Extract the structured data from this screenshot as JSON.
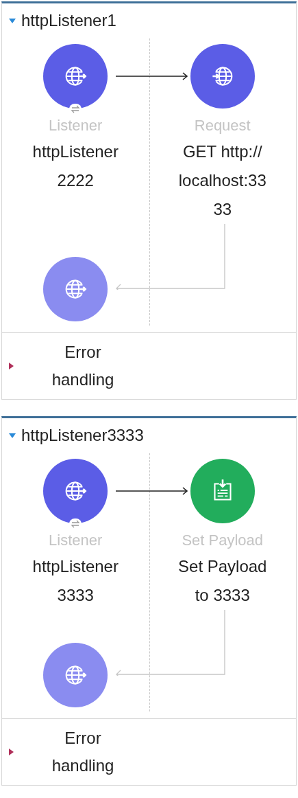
{
  "flows": [
    {
      "name": "httpListener1",
      "expanded": true,
      "nodes": [
        {
          "kind": "listener",
          "type_label": "Listener",
          "title_lines": [
            "httpListener",
            "2222"
          ]
        },
        {
          "kind": "request",
          "type_label": "Request",
          "title_lines": [
            "GET http://",
            "localhost:33",
            "33"
          ]
        }
      ],
      "response": {
        "kind": "listener-response"
      },
      "error_section": {
        "label_lines": [
          "Error",
          "handling"
        ],
        "expanded": false
      }
    },
    {
      "name": "httpListener3333",
      "expanded": true,
      "nodes": [
        {
          "kind": "listener",
          "type_label": "Listener",
          "title_lines": [
            "httpListener",
            "3333"
          ]
        },
        {
          "kind": "set-payload",
          "type_label": "Set Payload",
          "title_lines": [
            "Set Payload",
            "to 3333"
          ]
        }
      ],
      "response": {
        "kind": "listener-response"
      },
      "error_section": {
        "label_lines": [
          "Error",
          "handling"
        ],
        "expanded": false
      }
    }
  ]
}
